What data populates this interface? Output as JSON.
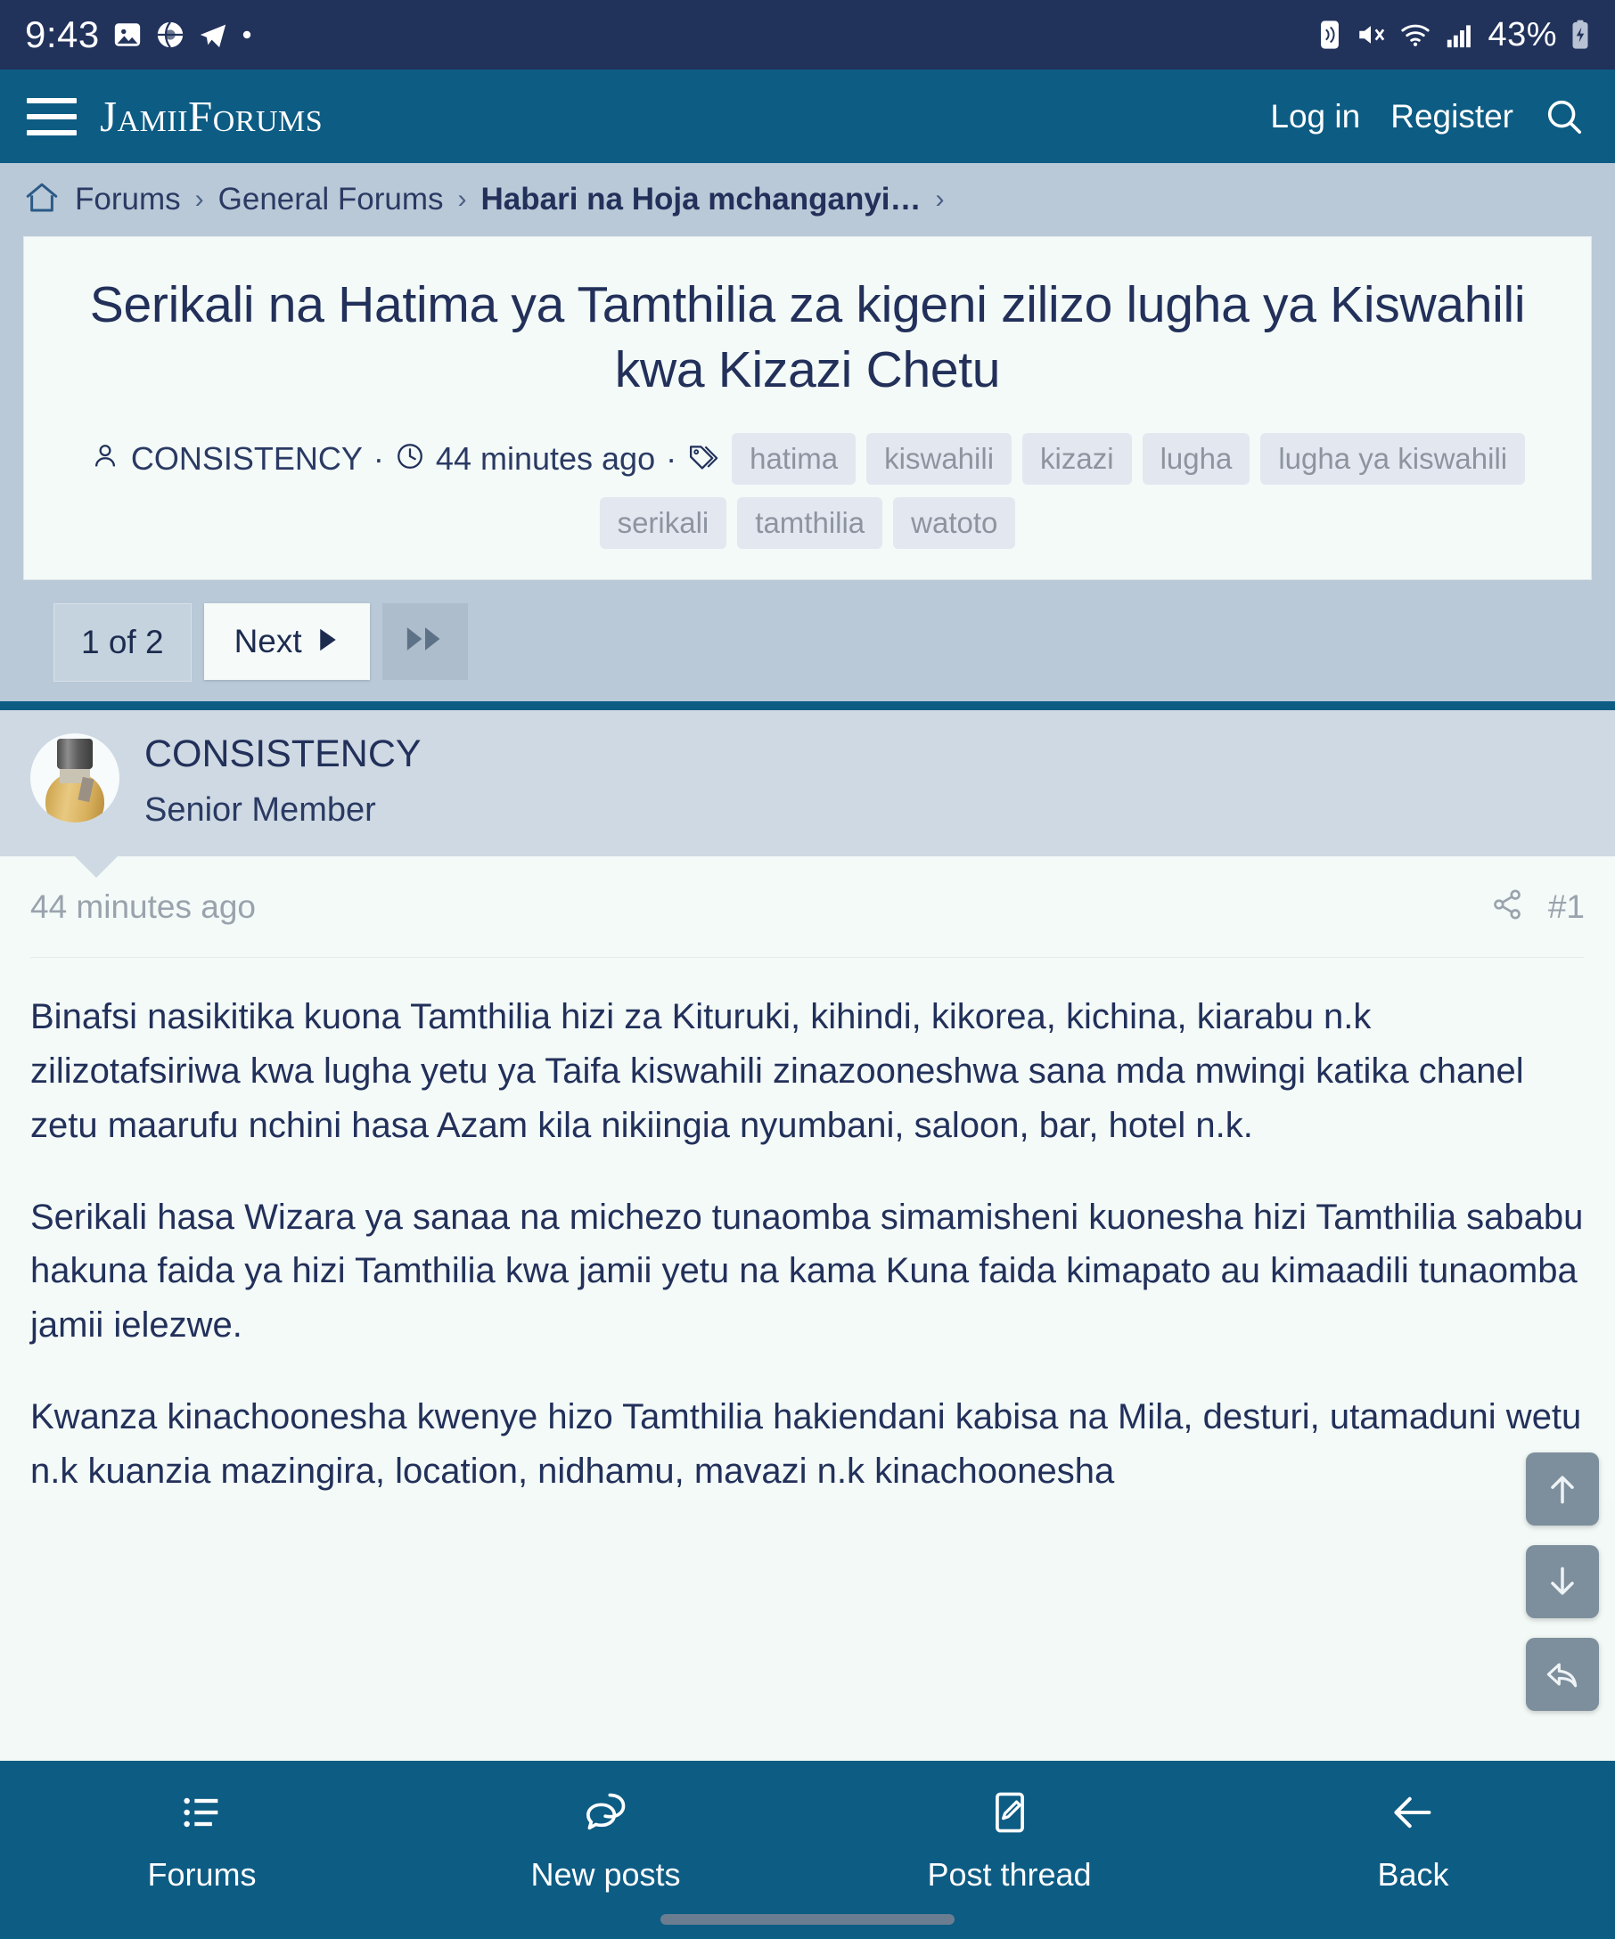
{
  "statusbar": {
    "time": "9:43",
    "left_icons": [
      "image-icon",
      "globe-icon",
      "telegram-icon",
      "dot-icon"
    ],
    "right_icons": [
      "nfc-icon",
      "mute-icon",
      "wifi-icon",
      "signal-icon"
    ],
    "battery_text": "43%",
    "battery_icon": "battery-charging-icon"
  },
  "header": {
    "menu_icon": "hamburger-menu-icon",
    "brand": "JamiiForums",
    "login_label": "Log in",
    "register_label": "Register",
    "search_icon": "search-icon",
    "background_color": "#0d5c84"
  },
  "breadcrumb": {
    "home_icon": "home-icon",
    "items": [
      {
        "label": "Forums",
        "active": false
      },
      {
        "label": "General Forums",
        "active": false
      },
      {
        "label": "Habari na Hoja mchanganyi…",
        "active": true
      }
    ],
    "separator": "›"
  },
  "thread": {
    "title": "Serikali na Hatima ya Tamthilia za kigeni zilizo lugha ya Kiswahili kwa Kizazi Chetu",
    "author_icon": "user-icon",
    "author": "CONSISTENCY",
    "time_icon": "clock-icon",
    "time": "44 minutes ago",
    "tag_icon": "tag-icon",
    "separator": "·",
    "tags": [
      "hatima",
      "kiswahili",
      "kizazi",
      "lugha",
      "lugha ya kiswahili",
      "serikali",
      "tamthilia",
      "watoto"
    ]
  },
  "pagination": {
    "count_label": "1 of 2",
    "next_label": "Next",
    "next_icon": "triangle-right-icon",
    "last_icon": "fast-forward-icon"
  },
  "post": {
    "avatar": "perfume-bottle-avatar",
    "author": "CONSISTENCY",
    "rank": "Senior Member",
    "time": "44 minutes ago",
    "share_icon": "share-icon",
    "number": "#1",
    "paragraphs": [
      "Binafsi nasikitika kuona Tamthilia hizi za Kituruki, kihindi, kikorea, kichina, kiarabu n.k zilizotafsiriwa kwa lugha yetu ya Taifa kiswahili zinazooneshwa sana mda mwingi katika chanel zetu maarufu nchini hasa Azam kila nikiingia nyumbani, saloon, bar, hotel n.k.",
      "Serikali hasa Wizara ya sanaa na michezo tunaomba simamisheni kuonesha hizi Tamthilia sababu hakuna faida ya hizi Tamthilia kwa jamii yetu na kama Kuna faida kimapato au kimaadili tunaomba jamii ielezwe.",
      "Kwanza kinachoonesha kwenye hizo Tamthilia hakiendani kabisa na Mila, desturi, utamaduni wetu n.k kuanzia mazingira, location, nidhamu, mavazi n.k kinachoonesha"
    ]
  },
  "fabs": [
    {
      "icon": "arrow-up-icon",
      "name": "scroll-to-top-button"
    },
    {
      "icon": "arrow-down-icon",
      "name": "scroll-to-bottom-button"
    },
    {
      "icon": "reply-icon",
      "name": "reply-button"
    }
  ],
  "bottomnav": {
    "items": [
      {
        "label": "Forums",
        "icon": "list-icon"
      },
      {
        "label": "New posts",
        "icon": "comments-icon"
      },
      {
        "label": "Post thread",
        "icon": "compose-icon"
      },
      {
        "label": "Back",
        "icon": "arrow-left-icon"
      }
    ]
  }
}
